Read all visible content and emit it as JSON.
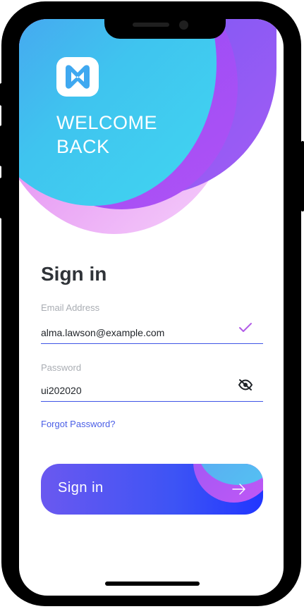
{
  "header": {
    "welcome_line1": "WELCOME",
    "welcome_line2": "BACK"
  },
  "form": {
    "title": "Sign in",
    "email": {
      "label": "Email Address",
      "value": "alma.lawson@example.com",
      "status_icon": "check-icon"
    },
    "password": {
      "label": "Password",
      "value": "ui202020",
      "toggle_icon": "eye-off-icon"
    },
    "forgot_link": "Forgot Password?",
    "submit": {
      "label": "Sign in",
      "icon": "arrow-right-icon"
    }
  },
  "colors": {
    "accent": "#3f55e6",
    "check": "#b25ce8",
    "header_blue": "#41c9ef",
    "header_violet": "#a35cf4",
    "header_pink": "#f3a3f0"
  }
}
